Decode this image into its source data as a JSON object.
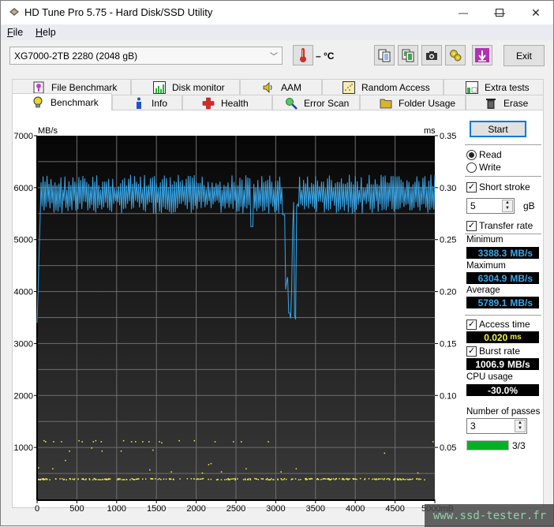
{
  "window": {
    "title": "HD Tune Pro 5.75 - Hard Disk/SSD Utility",
    "app_icon": "hdd-icon",
    "controls": {
      "minimize": "—",
      "maximize": "☐",
      "close": "✕"
    }
  },
  "menu": {
    "items": [
      {
        "label": "File",
        "accel": "F",
        "rest": "ile"
      },
      {
        "label": "Help",
        "accel": "H",
        "rest": "elp"
      }
    ]
  },
  "toolbar": {
    "drive": "XG7000-2TB 2280 (2048 gB)",
    "temperature": "– °C",
    "buttons": [
      {
        "name": "copy-text-button",
        "icon": "copy-text-icon"
      },
      {
        "name": "copy-image-button",
        "icon": "copy-image-icon"
      },
      {
        "name": "screenshot-button",
        "icon": "camera-icon"
      },
      {
        "name": "options-button",
        "icon": "gears-icon"
      },
      {
        "name": "save-button",
        "icon": "download-arrow-icon"
      }
    ],
    "exit_label": "Exit"
  },
  "tabs": {
    "top_row": [
      {
        "label": "File Benchmark",
        "icon": "file-benchmark-icon"
      },
      {
        "label": "Disk monitor",
        "icon": "disk-monitor-icon"
      },
      {
        "label": "AAM",
        "icon": "speaker-icon"
      },
      {
        "label": "Random Access",
        "icon": "random-access-icon"
      },
      {
        "label": "Extra tests",
        "icon": "extra-tests-icon"
      }
    ],
    "bottom_row": [
      {
        "label": "Benchmark",
        "icon": "lightbulb-icon",
        "active": true
      },
      {
        "label": "Info",
        "icon": "info-icon"
      },
      {
        "label": "Health",
        "icon": "health-cross-icon"
      },
      {
        "label": "Error Scan",
        "icon": "magnifier-icon"
      },
      {
        "label": "Folder Usage",
        "icon": "folder-icon"
      },
      {
        "label": "Erase",
        "icon": "trash-icon"
      }
    ]
  },
  "side": {
    "start_label": "Start",
    "mode": {
      "options": [
        "Read",
        "Write"
      ],
      "selected": "Read"
    },
    "short_stroke": {
      "label": "Short stroke",
      "checked": true,
      "value": "5",
      "unit": "gB"
    },
    "transfer_rate": {
      "label": "Transfer rate",
      "checked": true
    },
    "minimum": {
      "label": "Minimum",
      "value": "3388.3",
      "unit": "MB/s"
    },
    "maximum": {
      "label": "Maximum",
      "value": "6304.9",
      "unit": "MB/s"
    },
    "average": {
      "label": "Average",
      "value": "5789.1",
      "unit": "MB/s"
    },
    "access_time": {
      "label": "Access time",
      "checked": true,
      "value": "0.020",
      "unit": "ms"
    },
    "burst_rate": {
      "label": "Burst rate",
      "checked": true,
      "value": "1006.9",
      "unit": "MB/s"
    },
    "cpu_usage": {
      "label": "CPU usage",
      "value": "-30.0%"
    },
    "passes": {
      "label": "Number of passes",
      "value": "3",
      "progress_fraction": 1.0,
      "progress_label": "3/3"
    }
  },
  "colors": {
    "transfer_line": "#3aa7e8",
    "access_points": "#f3f33a",
    "progress": "#06b025",
    "start_border": "#0078d7"
  },
  "watermark": "www.ssd-tester.fr",
  "chart_data": {
    "type": "line",
    "title": "",
    "xlabel": "mB",
    "ylabel": "MB/s",
    "y2label": "ms",
    "xlim": [
      0,
      5000
    ],
    "ylim": [
      0,
      7000
    ],
    "y2lim": [
      0,
      0.35
    ],
    "x_ticks": [
      "0",
      "500",
      "1000",
      "1500",
      "2000",
      "2500",
      "3000",
      "3500",
      "4000",
      "4500",
      "5000mB"
    ],
    "y_ticks": [
      "1000",
      "2000",
      "3000",
      "4000",
      "5000",
      "6000",
      "7000"
    ],
    "y2_ticks": [
      "0.05",
      "0.10",
      "0.15",
      "0.20",
      "0.25",
      "0.30",
      "0.35"
    ],
    "grid": true,
    "series": [
      {
        "name": "Transfer rate (MB/s)",
        "axis": "left",
        "description": "oscillates roughly between 5500 and 6250 MB/s, ramps up from ~3400 at start, dip to ~3400 around 3150-3250 mB",
        "band_low": 5500,
        "band_high": 6250,
        "start_value": 3400,
        "dips": [
          {
            "x": 2700,
            "value": 5250
          },
          {
            "x": 3150,
            "value": 3400
          },
          {
            "x": 3200,
            "value": 3700
          },
          {
            "x": 3250,
            "value": 3400
          }
        ]
      },
      {
        "name": "Access time (ms)",
        "axis": "right",
        "type": "scatter",
        "description": "dense band near 0.02 ms, scattered outliers near 0.055 ms and 0.03 ms",
        "band_value": 0.02,
        "outliers": [
          {
            "x": 80,
            "y": 0.057
          },
          {
            "x": 100,
            "y": 0.056
          },
          {
            "x": 200,
            "y": 0.056
          },
          {
            "x": 300,
            "y": 0.056
          },
          {
            "x": 400,
            "y": 0.047
          },
          {
            "x": 350,
            "y": 0.038
          },
          {
            "x": 520,
            "y": 0.057
          },
          {
            "x": 560,
            "y": 0.056
          },
          {
            "x": 680,
            "y": 0.05
          },
          {
            "x": 700,
            "y": 0.056
          },
          {
            "x": 730,
            "y": 0.057
          },
          {
            "x": 800,
            "y": 0.056
          },
          {
            "x": 810,
            "y": 0.047
          },
          {
            "x": 1050,
            "y": 0.047
          },
          {
            "x": 1080,
            "y": 0.057
          },
          {
            "x": 1180,
            "y": 0.056
          },
          {
            "x": 1230,
            "y": 0.056
          },
          {
            "x": 1320,
            "y": 0.056
          },
          {
            "x": 1400,
            "y": 0.056
          },
          {
            "x": 1450,
            "y": 0.048
          },
          {
            "x": 1530,
            "y": 0.056
          },
          {
            "x": 1560,
            "y": 0.055
          },
          {
            "x": 1780,
            "y": 0.057
          },
          {
            "x": 1970,
            "y": 0.057
          },
          {
            "x": 2150,
            "y": 0.034
          },
          {
            "x": 2180,
            "y": 0.035
          },
          {
            "x": 2230,
            "y": 0.056
          },
          {
            "x": 2460,
            "y": 0.056
          },
          {
            "x": 2560,
            "y": 0.056
          },
          {
            "x": 2900,
            "y": 0.056
          },
          {
            "x": 4360,
            "y": 0.045
          },
          {
            "x": 4970,
            "y": 0.056
          },
          {
            "x": 10,
            "y": 0.031
          },
          {
            "x": 190,
            "y": 0.03
          },
          {
            "x": 1410,
            "y": 0.029
          },
          {
            "x": 1680,
            "y": 0.027
          },
          {
            "x": 2070,
            "y": 0.026
          },
          {
            "x": 2310,
            "y": 0.027
          },
          {
            "x": 3060,
            "y": 0.027
          },
          {
            "x": 3250,
            "y": 0.03
          },
          {
            "x": 2620,
            "y": 0.03
          },
          {
            "x": 4780,
            "y": 0.026
          }
        ]
      }
    ]
  }
}
